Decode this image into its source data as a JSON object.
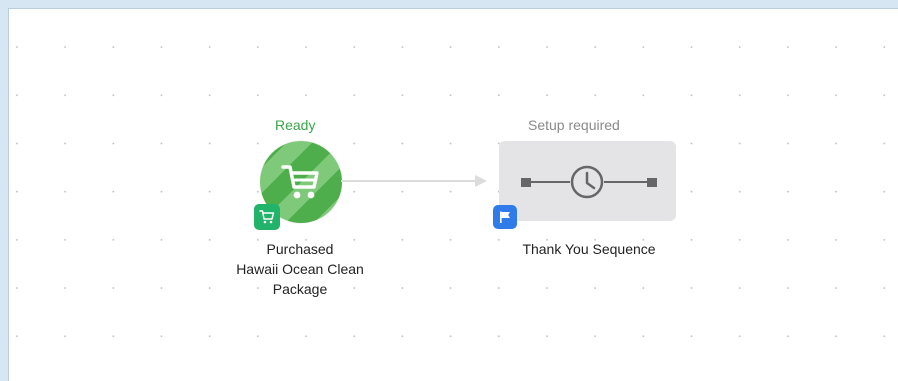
{
  "trigger": {
    "status": "Ready",
    "label_lines": [
      "Purchased",
      "Hawaii Ocean Clean",
      "Package"
    ],
    "icon": "shopping-cart-icon",
    "badge_icon": "shopping-cart-icon",
    "status_color": "#3aa54a",
    "stripe_colors": [
      "#4fae4c",
      "#7fc97a"
    ],
    "badge_color": "#22b36a"
  },
  "action": {
    "status": "Setup required",
    "label": "Thank You Sequence",
    "icon": "clock-icon",
    "badge_icon": "flag-icon",
    "status_color": "#8a8a8a",
    "badge_color": "#2f7bea"
  },
  "connector": {
    "icon": "arrow-right-icon",
    "color": "#dcdcdc"
  }
}
